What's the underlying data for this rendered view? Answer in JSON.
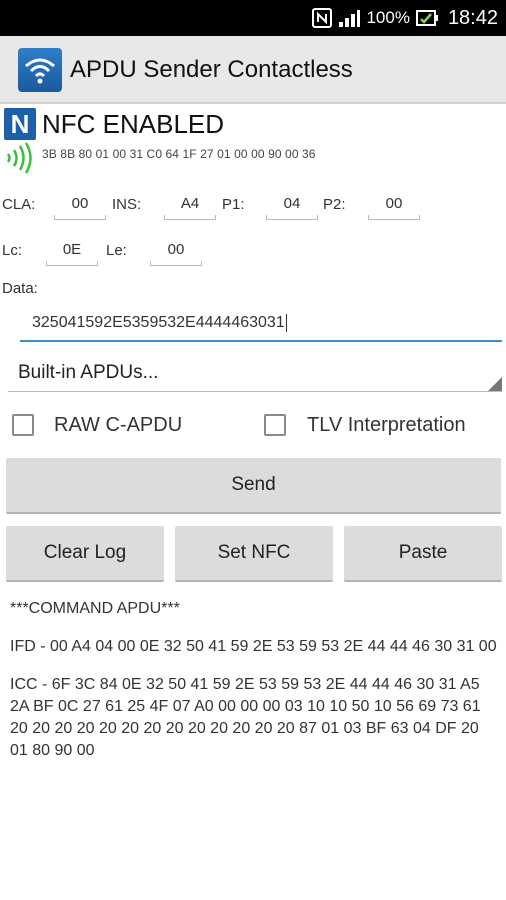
{
  "status_bar": {
    "battery": "100%",
    "time": "18:42",
    "icons": [
      "nfc-icon",
      "signal-icon",
      "battery-icon"
    ]
  },
  "app": {
    "title": "APDU Sender Contactless"
  },
  "nfc": {
    "status": "NFC ENABLED",
    "atr": "3B 8B 80 01 00 31 C0 64 1F 27 01 00 00 90 00 36"
  },
  "apdu_fields": {
    "cla_label": "CLA:",
    "cla_value": "00",
    "ins_label": "INS:",
    "ins_value": "A4",
    "p1_label": "P1:",
    "p1_value": "04",
    "p2_label": "P2:",
    "p2_value": "00",
    "lc_label": "Lc:",
    "lc_value": "0E",
    "le_label": "Le:",
    "le_value": "00"
  },
  "data_field": {
    "label": "Data:",
    "value": "325041592E5359532E4444463031"
  },
  "builtin_spinner": {
    "selected": "Built-in APDUs..."
  },
  "options": {
    "raw_label": "RAW C-APDU",
    "tlv_label": "TLV Interpretation"
  },
  "buttons": {
    "send": "Send",
    "clear_log": "Clear Log",
    "set_nfc": "Set NFC",
    "paste": "Paste"
  },
  "log": {
    "header": "***COMMAND APDU***",
    "ifd": "IFD - 00 A4 04 00 0E 32 50 41 59 2E 53 59 53 2E 44 44 46 30 31 00",
    "icc": "ICC - 6F 3C 84 0E 32 50 41 59 2E 53 59 53 2E 44 44 46 30 31 A5 2A BF 0C 27 61 25 4F 07 A0 00 00 00 03 10 10 50 10 56 69 73 61 20 20 20 20 20 20 20 20 20 20 20 20 20 87 01 03 BF 63 04 DF 20 01 80 90 00"
  },
  "colors": {
    "accent": "#3a8ec9",
    "nfc_blue": "#1d5fa8",
    "signal_green": "#3bbf3b",
    "button_bg": "#dcdcdc"
  }
}
